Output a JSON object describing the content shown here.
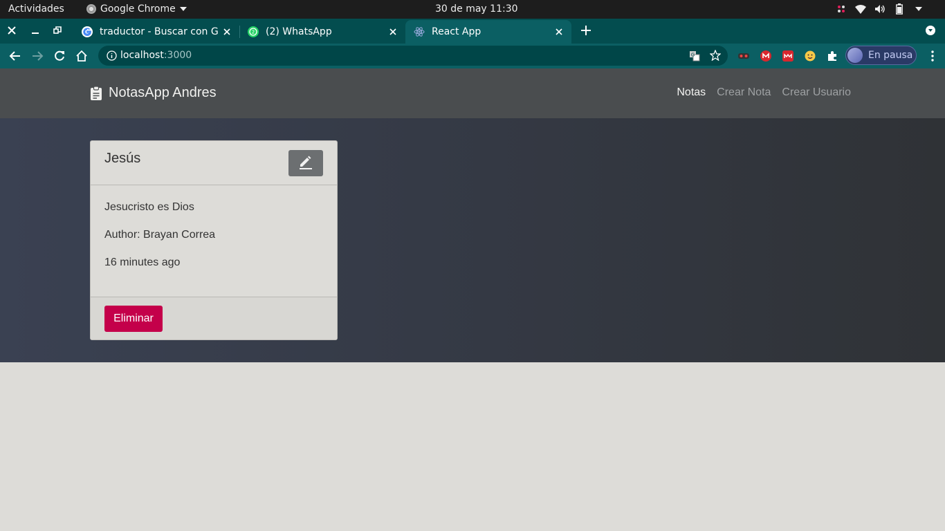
{
  "system_bar": {
    "activities": "Actividades",
    "app_name": "Google Chrome",
    "clock": "30 de may  11:30"
  },
  "browser": {
    "tabs": [
      {
        "title": "traductor - Buscar con Go",
        "icon": "google-icon"
      },
      {
        "title": "(2) WhatsApp",
        "icon": "whatsapp-icon"
      },
      {
        "title": "React App",
        "icon": "react-icon",
        "active": true
      }
    ],
    "url_host": "localhost",
    "url_port": ":3000",
    "profile_label": "En pausa",
    "accent_color": "#0b5f63"
  },
  "app": {
    "brand": "NotasApp Andres",
    "nav": [
      {
        "label": "Notas",
        "active": true
      },
      {
        "label": "Crear Nota",
        "active": false
      },
      {
        "label": "Crear Usuario",
        "active": false
      }
    ]
  },
  "note": {
    "title": "Jesús",
    "content": "Jesucristo es Dios",
    "author": "Author: Brayan Correa",
    "time": "16 minutes ago",
    "delete_label": "Eliminar",
    "delete_color": "#c4004a"
  }
}
